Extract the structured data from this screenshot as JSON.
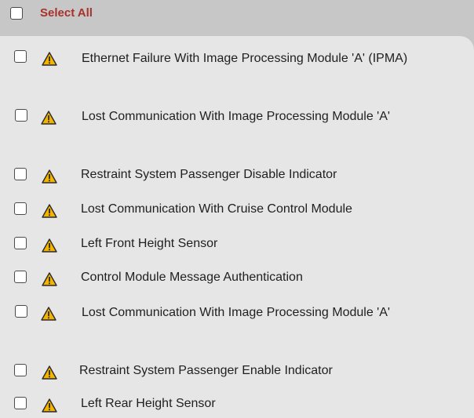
{
  "header": {
    "select_all_label": "Select All"
  },
  "icons": {
    "warning": "warning-icon",
    "checkbox": "checkbox-icon"
  },
  "colors": {
    "select_all_text": "#a8322b",
    "warning_fill": "#f2b400",
    "header_bg": "#c7c7c7",
    "panel_bg": "#e6e6e6"
  },
  "items": [
    {
      "label": "Ethernet Failure With Image Processing Module 'A' (IPMA)"
    },
    {
      "label": "Lost Communication With Image Processing Module 'A'"
    },
    {
      "label": "Restraint System Passenger Disable Indicator"
    },
    {
      "label": "Lost Communication With Cruise Control Module"
    },
    {
      "label": "Left Front Height Sensor"
    },
    {
      "label": "Control Module Message Authentication"
    },
    {
      "label": "Lost Communication With Image Processing Module 'A'"
    },
    {
      "label": "Restraint System Passenger Enable Indicator"
    },
    {
      "label": "Left Rear Height Sensor"
    }
  ]
}
